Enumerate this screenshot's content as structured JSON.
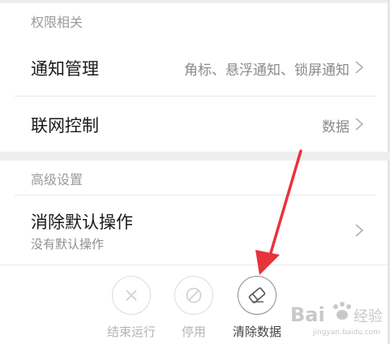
{
  "sections": {
    "permissions": {
      "header": "权限相关"
    },
    "advanced": {
      "header": "高级设置"
    }
  },
  "rows": {
    "notification": {
      "title": "通知管理",
      "value": "角标、悬浮通知、锁屏通知"
    },
    "network": {
      "title": "联网控制",
      "value": "数据"
    },
    "default_actions": {
      "title": "消除默认操作",
      "subtitle": "没有默认操作"
    }
  },
  "actions": {
    "force_stop": {
      "label": "结束运行",
      "icon": "close-icon",
      "enabled": false
    },
    "disable": {
      "label": "停用",
      "icon": "block-icon",
      "enabled": false
    },
    "clear_data": {
      "label": "清除数据",
      "icon": "eraser-icon",
      "enabled": true
    }
  },
  "watermark": {
    "text": "Bai 经验",
    "sub": "jingyan.baidu.com"
  },
  "colors": {
    "annotation_arrow": "#e8323c",
    "background": "#ffffff",
    "separator": "#eeeeee"
  }
}
